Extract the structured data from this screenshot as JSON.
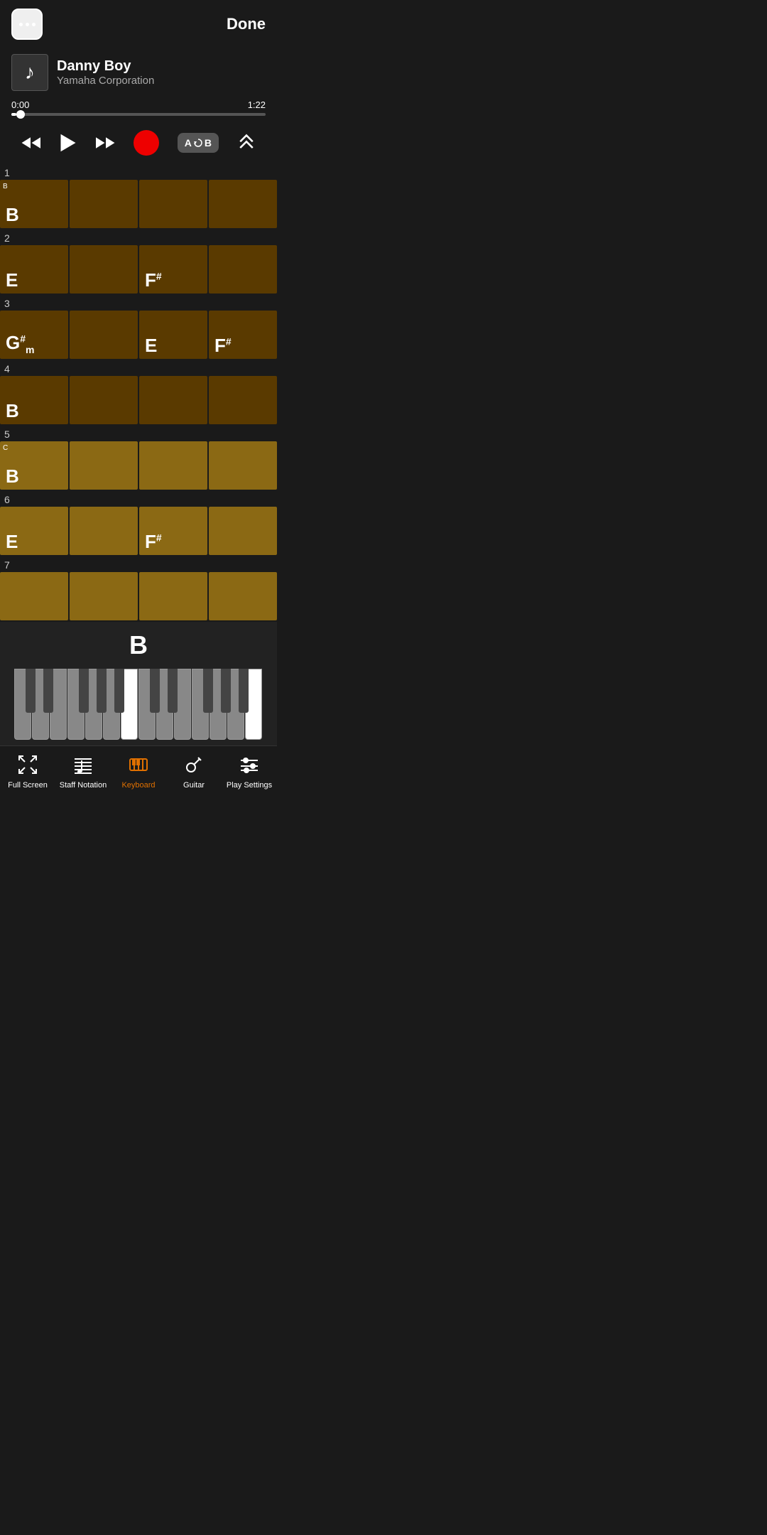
{
  "header": {
    "menu_label": "menu",
    "done_label": "Done"
  },
  "song": {
    "title": "Danny Boy",
    "artist": "Yamaha Corporation",
    "current_time": "0:00",
    "total_time": "1:22",
    "progress_percent": 2
  },
  "controls": {
    "rewind_label": "rewind",
    "play_label": "play",
    "forward_label": "fast-forward",
    "record_label": "record",
    "ab_label": "A↺B",
    "scroll_label": "scroll-up"
  },
  "bars": [
    {
      "number": "1",
      "chords": [
        {
          "note": "B",
          "sharp": "",
          "minor": "",
          "active": false,
          "section": "B"
        },
        {
          "note": "",
          "sharp": "",
          "minor": "",
          "active": false,
          "section": ""
        },
        {
          "note": "",
          "sharp": "",
          "minor": "",
          "active": false,
          "section": ""
        },
        {
          "note": "",
          "sharp": "",
          "minor": "",
          "active": false,
          "section": ""
        }
      ]
    },
    {
      "number": "2",
      "chords": [
        {
          "note": "E",
          "sharp": "",
          "minor": "",
          "active": false,
          "section": ""
        },
        {
          "note": "",
          "sharp": "",
          "minor": "",
          "active": false,
          "section": ""
        },
        {
          "note": "F",
          "sharp": "#",
          "minor": "",
          "active": false,
          "section": ""
        },
        {
          "note": "",
          "sharp": "",
          "minor": "",
          "active": false,
          "section": ""
        }
      ]
    },
    {
      "number": "3",
      "chords": [
        {
          "note": "G",
          "sharp": "#",
          "minor": "m",
          "active": false,
          "section": ""
        },
        {
          "note": "",
          "sharp": "",
          "minor": "",
          "active": false,
          "section": ""
        },
        {
          "note": "E",
          "sharp": "",
          "minor": "",
          "active": false,
          "section": ""
        },
        {
          "note": "F",
          "sharp": "#",
          "minor": "",
          "active": false,
          "section": ""
        }
      ]
    },
    {
      "number": "4",
      "chords": [
        {
          "note": "B",
          "sharp": "",
          "minor": "",
          "active": false,
          "section": ""
        },
        {
          "note": "",
          "sharp": "",
          "minor": "",
          "active": false,
          "section": ""
        },
        {
          "note": "",
          "sharp": "",
          "minor": "",
          "active": false,
          "section": ""
        },
        {
          "note": "",
          "sharp": "",
          "minor": "",
          "active": false,
          "section": ""
        }
      ]
    },
    {
      "number": "5",
      "chords": [
        {
          "note": "B",
          "sharp": "",
          "minor": "",
          "active": true,
          "section": "C"
        },
        {
          "note": "",
          "sharp": "",
          "minor": "",
          "active": true,
          "section": ""
        },
        {
          "note": "",
          "sharp": "",
          "minor": "",
          "active": true,
          "section": ""
        },
        {
          "note": "",
          "sharp": "",
          "minor": "",
          "active": true,
          "section": ""
        }
      ]
    },
    {
      "number": "6",
      "chords": [
        {
          "note": "E",
          "sharp": "",
          "minor": "",
          "active": true,
          "section": ""
        },
        {
          "note": "",
          "sharp": "",
          "minor": "",
          "active": true,
          "section": ""
        },
        {
          "note": "F",
          "sharp": "#",
          "minor": "",
          "active": true,
          "section": ""
        },
        {
          "note": "",
          "sharp": "",
          "minor": "",
          "active": true,
          "section": ""
        }
      ]
    },
    {
      "number": "7",
      "chords": [
        {
          "note": "",
          "sharp": "",
          "minor": "",
          "active": true,
          "section": ""
        },
        {
          "note": "",
          "sharp": "",
          "minor": "",
          "active": true,
          "section": ""
        },
        {
          "note": "",
          "sharp": "",
          "minor": "",
          "active": true,
          "section": ""
        },
        {
          "note": "",
          "sharp": "",
          "minor": "",
          "active": true,
          "section": ""
        }
      ]
    }
  ],
  "piano": {
    "current_chord": "B",
    "white_keys": [
      {
        "id": "c3",
        "lit": false
      },
      {
        "id": "d3",
        "lit": false
      },
      {
        "id": "e3",
        "lit": false
      },
      {
        "id": "f3",
        "lit": false
      },
      {
        "id": "g3",
        "lit": false
      },
      {
        "id": "a3",
        "lit": false
      },
      {
        "id": "b3",
        "lit": true
      },
      {
        "id": "c4",
        "lit": false
      },
      {
        "id": "d4",
        "lit": false
      },
      {
        "id": "e4",
        "lit": false
      },
      {
        "id": "f4",
        "lit": false
      },
      {
        "id": "g4",
        "lit": false
      },
      {
        "id": "a4",
        "lit": false
      },
      {
        "id": "b4",
        "lit": true
      }
    ]
  },
  "bottom_nav": {
    "items": [
      {
        "id": "fullscreen",
        "label": "Full Screen",
        "active": false,
        "icon": "fullscreen"
      },
      {
        "id": "staff",
        "label": "Staff Notation",
        "active": false,
        "icon": "staff"
      },
      {
        "id": "keyboard",
        "label": "Keyboard",
        "active": true,
        "icon": "keyboard"
      },
      {
        "id": "guitar",
        "label": "Guitar",
        "active": false,
        "icon": "guitar"
      },
      {
        "id": "settings",
        "label": "Play Settings",
        "active": false,
        "icon": "settings"
      }
    ]
  }
}
